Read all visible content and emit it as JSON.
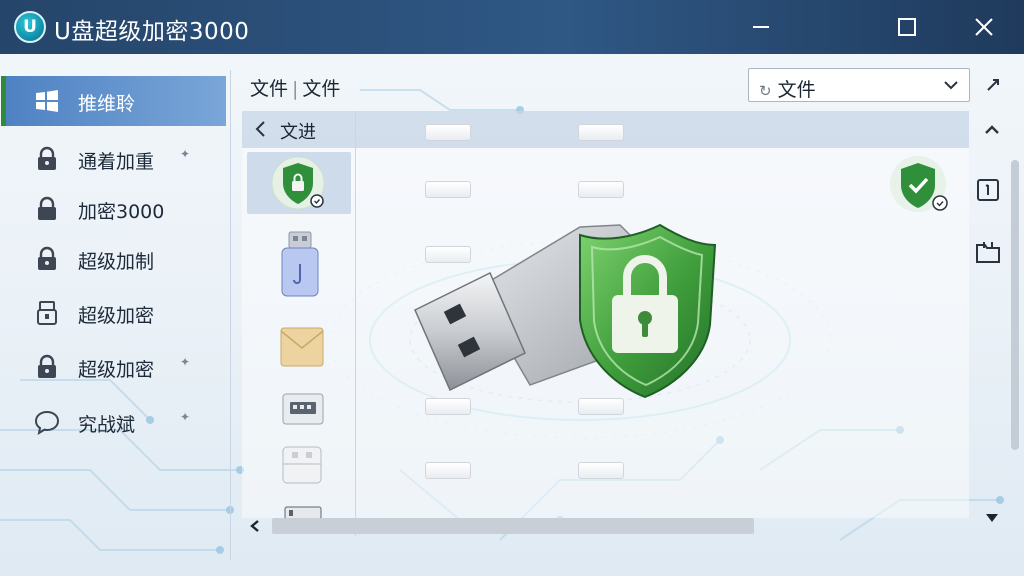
{
  "window": {
    "logo_letter": "U",
    "title": "U盘超级加密3000"
  },
  "title_buttons": [
    {
      "name": "minimize",
      "icon": "minimize-icon"
    },
    {
      "name": "maximize",
      "icon": "maximize-icon"
    },
    {
      "name": "close",
      "icon": "close-icon"
    }
  ],
  "sidebar": {
    "items": [
      {
        "label": "推维聆",
        "icon": "windows-icon",
        "active": true,
        "star": ""
      },
      {
        "label": "通着加重",
        "icon": "lock-icon",
        "active": false,
        "star": "✦"
      },
      {
        "label": "加密3000",
        "icon": "lock-icon",
        "active": false,
        "star": ""
      },
      {
        "label": "超级加制",
        "icon": "lock-icon",
        "active": false,
        "star": ""
      },
      {
        "label": "超级加密",
        "icon": "usb-drive-icon",
        "active": false,
        "star": ""
      },
      {
        "label": "超级加密",
        "icon": "lock-icon",
        "active": false,
        "star": "✦"
      },
      {
        "label": "究战斌",
        "icon": "chat-bubble-icon",
        "active": false,
        "star": "✦"
      }
    ]
  },
  "header": {
    "breadcrumb_1": "文件",
    "breadcrumb_sep": "|",
    "breadcrumb_2": "文件",
    "select_value": "文件",
    "select_prefix_icon": "refresh-icon"
  },
  "list": {
    "back_label": "文进"
  },
  "colors": {
    "titlebar": "#2f5885",
    "accent_green": "#3a9a3f",
    "active_item": "#4f82c3"
  }
}
